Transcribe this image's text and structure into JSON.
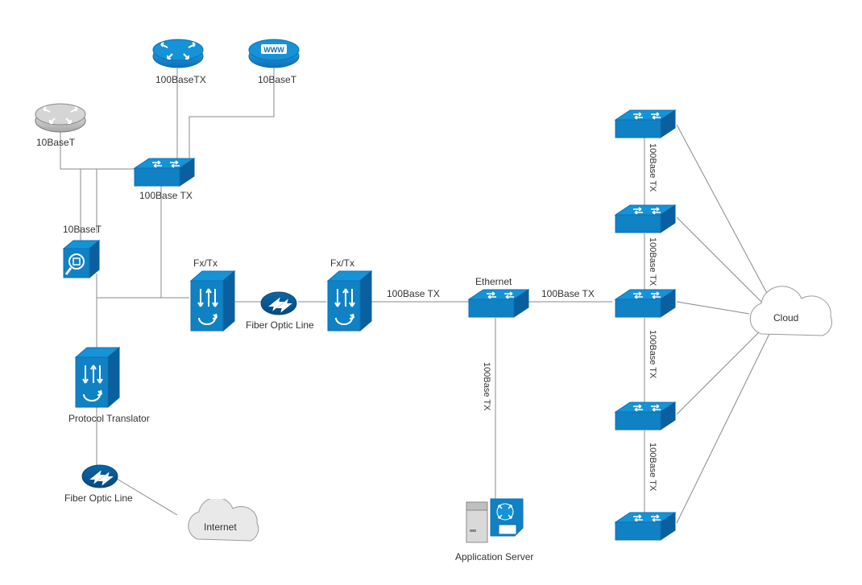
{
  "nodes": {
    "router_gray": {
      "label": "10BaseT"
    },
    "router_blue1": {
      "label": "100BaseTX"
    },
    "router_www": {
      "label": "10BaseT",
      "text": "WWW"
    },
    "magnifier": {
      "label": "10BaseT"
    },
    "switch_left": {
      "label": "100Base TX"
    },
    "proto_left": {
      "label": "Protocol Translator"
    },
    "fxtx1": {
      "label": "Fx/Tx"
    },
    "fxtx2": {
      "label": "Fx/Tx"
    },
    "fiber1": {
      "label": "Fiber Optic Line"
    },
    "fiber2": {
      "label": "Fiber Optic Line"
    },
    "internet": {
      "label": "Internet"
    },
    "ethernet": {
      "label": "Ethernet"
    },
    "appserver": {
      "label": "Application Server"
    },
    "cloud": {
      "label": "Cloud"
    },
    "sw_r1": {},
    "sw_r2": {},
    "sw_r3": {},
    "sw_r4": {},
    "sw_r5": {}
  },
  "edgeLabels": {
    "e1": "100Base TX",
    "e2": "100Base TX",
    "v1": "100Base TX",
    "v2": "100Base TX",
    "v3": "100Base TX",
    "v4": "100Base TX",
    "v5": "100Base TX"
  }
}
